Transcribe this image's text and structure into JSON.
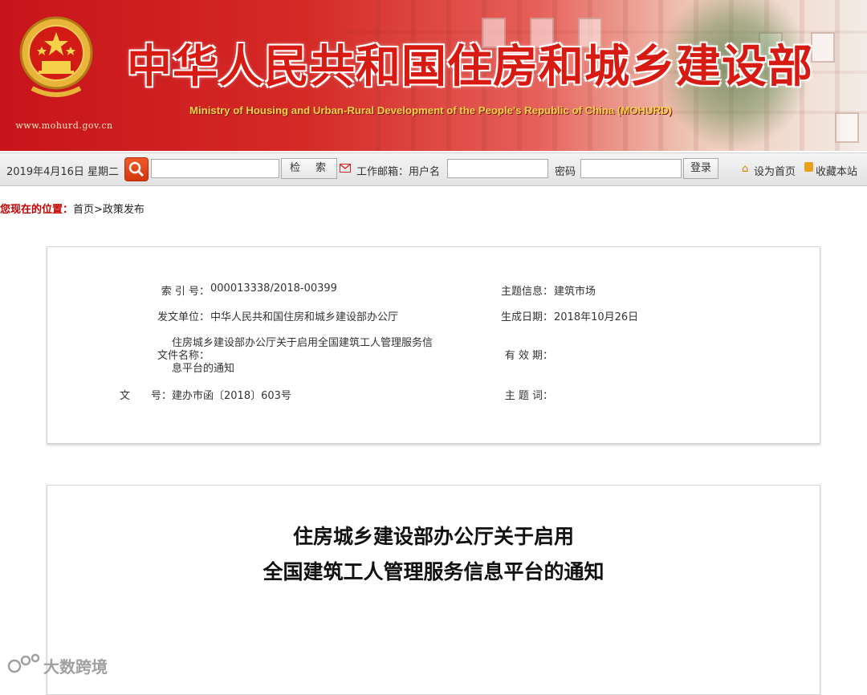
{
  "header": {
    "title": "中华人民共和国住房和城乡建设部",
    "subtitle": "Ministry of Housing and Urban-Rural Development of the People's Republic of China (MOHURD)",
    "url": "www.mohurd.gov.cn",
    "emblem_icon": "national-emblem-icon",
    "colors": {
      "banner_red": "#c8141b",
      "title_red": "#d81b12",
      "subtitle_gold": "#f6d24a"
    }
  },
  "toolbar": {
    "date": "2019年4月16日 星期二",
    "search_icon": "search-icon",
    "search_button": "检　索",
    "mail_icon": "mail-icon",
    "mailbox_label": "工作邮箱：用户名",
    "password_label": "密码",
    "login_button": "登录",
    "homepage_icon": "home-icon",
    "set_homepage": "设为首页",
    "bookmark_icon": "bookmark-icon",
    "bookmark": "收藏本站"
  },
  "breadcrumb": {
    "label": "您现在的位置：",
    "path": "首页>政策发布"
  },
  "meta": {
    "index_label": "索 引 号：",
    "index_value": "000013338/2018-00399",
    "topic_label": "主题信息：",
    "topic_value": "建筑市场",
    "issuer_label": "发文单位：",
    "issuer_value": "中华人民共和国住房和城乡建设部办公厅",
    "date_label": "生成日期：",
    "date_value": "2018年10月26日",
    "name_label": "文件名称：",
    "name_value_line1": "住房城乡建设部办公厅关于启用全国建筑工人管理服务信",
    "name_value_line2": "息平台的通知",
    "validity_label": "有 效 期：",
    "validity_value": "",
    "docno_label": "文　　号：",
    "docno_value": "建办市函〔2018〕603号",
    "keywords_label": "主 题 词：",
    "keywords_value": ""
  },
  "article": {
    "title_line1": "住房城乡建设部办公厅关于启用",
    "title_line2": "全国建筑工人管理服务信息平台的通知"
  },
  "watermark": {
    "text": "大数跨境",
    "icon": "watermark-logo-icon"
  }
}
